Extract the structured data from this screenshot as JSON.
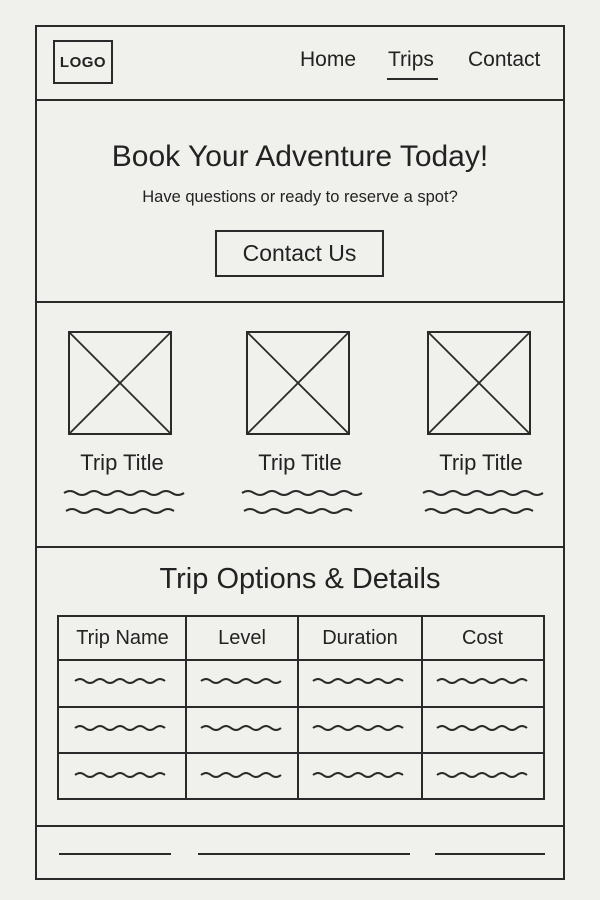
{
  "header": {
    "logo_label": "LOGO",
    "nav": [
      "Home",
      "Trips",
      "Contact"
    ]
  },
  "hero": {
    "title": "Book Your Adventure Today!",
    "subtitle": "Have questions or ready to reserve a spot?",
    "button_label": "Contact Us"
  },
  "trips": [
    {
      "title": "Trip Title",
      "image": "image-placeholder-icon"
    },
    {
      "title": "Trip Title",
      "image": "image-placeholder-icon"
    },
    {
      "title": "Trip Title",
      "image": "image-placeholder-icon"
    }
  ],
  "options": {
    "title": "Trip Options & Details",
    "columns": [
      "Trip Name",
      "Level",
      "Duration",
      "Cost"
    ]
  }
}
